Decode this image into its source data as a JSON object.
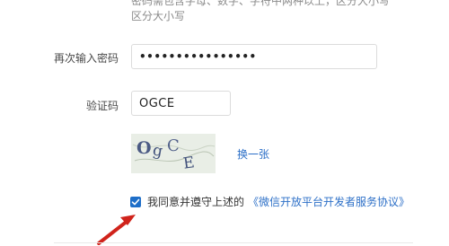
{
  "password_hint": {
    "line1": "密码需包含字母、数字、字符中两种以上，区分大小写",
    "line2": "区分大小写"
  },
  "confirm_password": {
    "label": "再次输入密码",
    "value": "••••••••••••••••"
  },
  "captcha": {
    "label": "验证码",
    "value": "OGCE",
    "refresh_label": "换一张",
    "image_text": "OgCE"
  },
  "agreement": {
    "checked": true,
    "text": "我同意并遵守上述的",
    "link": "《微信开放平台开发者服务协议》"
  },
  "colors": {
    "link": "#2c6fc7",
    "checkbox": "#1e6ec8",
    "arrow": "#d0231b"
  }
}
